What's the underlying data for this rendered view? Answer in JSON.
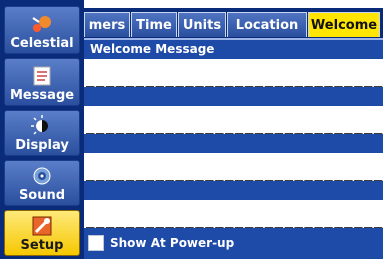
{
  "sidebar": {
    "items": [
      {
        "label": "Celestial",
        "icon": "celestial-icon"
      },
      {
        "label": "Message",
        "icon": "message-icon"
      },
      {
        "label": "Display",
        "icon": "display-icon"
      },
      {
        "label": "Sound",
        "icon": "sound-icon"
      },
      {
        "label": "Setup",
        "icon": "setup-icon",
        "active": true
      }
    ]
  },
  "tabs": [
    {
      "label": "mers"
    },
    {
      "label": "Time"
    },
    {
      "label": "Units"
    },
    {
      "label": "Location"
    },
    {
      "label": "Welcome",
      "active": true
    }
  ],
  "panel": {
    "title": "Welcome Message",
    "lines": [
      "________________________________",
      "________________________________",
      "________________________________",
      "________________________________"
    ],
    "checkbox_label": "Show At Power-up",
    "checkbox_checked": false
  },
  "colors": {
    "panel_bg": "#1e4aa8",
    "sidebar_bg": "#0a2a7a",
    "active_tab": "#ffe500",
    "active_sidebar": "#f5c800"
  }
}
